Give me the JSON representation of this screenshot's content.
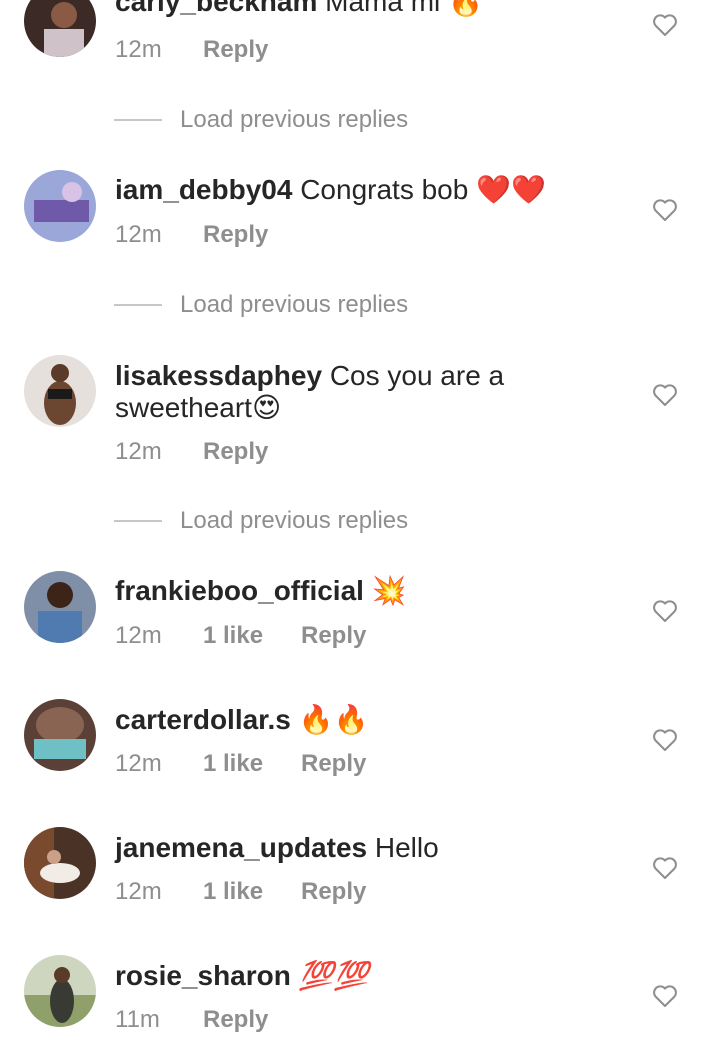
{
  "comments": [
    {
      "username": "carly_beckham",
      "text": "Mama mi",
      "emoji": "🔥",
      "time": "12m",
      "likes": "",
      "reply": "Reply"
    },
    {
      "username": "iam_debby04",
      "text": "Congrats bob",
      "emoji": "❤️❤️",
      "time": "12m",
      "likes": "",
      "reply": "Reply"
    },
    {
      "username": "lisakessdaphey",
      "text": "Cos you are a sweetheart",
      "emoji": "😍",
      "time": "12m",
      "likes": "",
      "reply": "Reply"
    },
    {
      "username": "frankieboo_official",
      "text": "",
      "emoji": "💥",
      "time": "12m",
      "likes": "1 like",
      "reply": "Reply"
    },
    {
      "username": "carterdollar.s",
      "text": "",
      "emoji": "🔥🔥",
      "time": "12m",
      "likes": "1 like",
      "reply": "Reply"
    },
    {
      "username": "janemena_updates",
      "text": "Hello",
      "emoji": "",
      "time": "12m",
      "likes": "1 like",
      "reply": "Reply"
    },
    {
      "username": "rosie_sharon",
      "text": "",
      "emoji": "💯💯",
      "time": "11m",
      "likes": "",
      "reply": "Reply"
    }
  ],
  "load_previous": [
    "Load previous replies",
    "Load previous replies",
    "Load previous replies"
  ],
  "icons": {
    "like": "heart-outline-icon"
  },
  "colors": {
    "text": "#262626",
    "muted": "#8e8e8e",
    "divider": "#c7c7c7"
  }
}
